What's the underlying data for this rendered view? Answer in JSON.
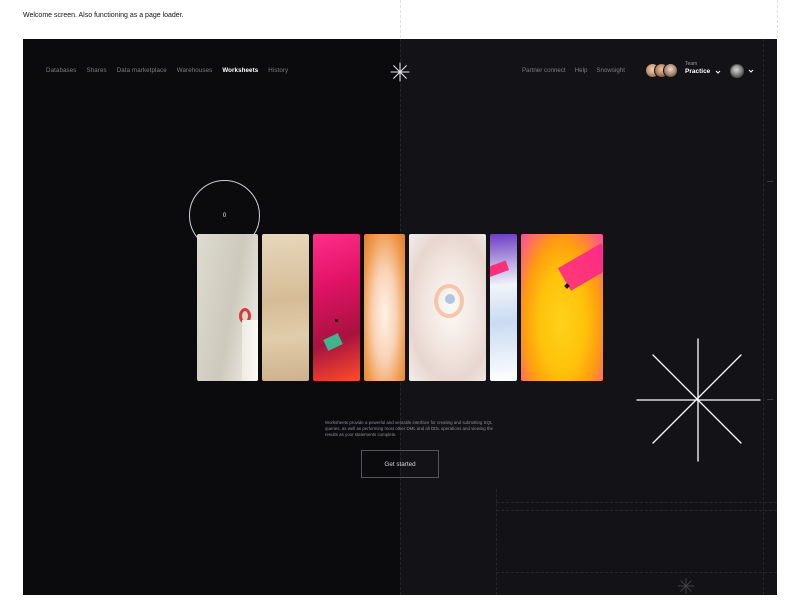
{
  "caption": "Welcome screen. Also functioning as a page loader.",
  "nav": {
    "items": [
      {
        "label": "Databases",
        "active": false
      },
      {
        "label": "Shares",
        "active": false
      },
      {
        "label": "Data marketplace",
        "active": false
      },
      {
        "label": "Warehouses",
        "active": false
      },
      {
        "label": "Worksheets",
        "active": true
      },
      {
        "label": "History",
        "active": false
      }
    ]
  },
  "right_nav": {
    "items": [
      "Partner connect",
      "Help",
      "Snowsight"
    ]
  },
  "team": {
    "label": "Team",
    "name": "Practice"
  },
  "loader": {
    "counter": "0"
  },
  "description": "Worksheets provide a powerful and versatile interface for creating and submitting SQL queries, as well as performing most other DML and all DDL operations and viewing the results as your statements complete.",
  "cta": {
    "label": "Get started"
  },
  "icons": {
    "logo": "asterisk-logo-icon",
    "team_chevron": "chevron-down-icon",
    "profile_chevron": "chevron-down-icon",
    "decor": "asterisk-icon"
  },
  "colors": {
    "background_left": "#0b0b0e",
    "background_right": "#121217",
    "text_muted": "#7c7c86",
    "text_active": "#ffffff"
  }
}
